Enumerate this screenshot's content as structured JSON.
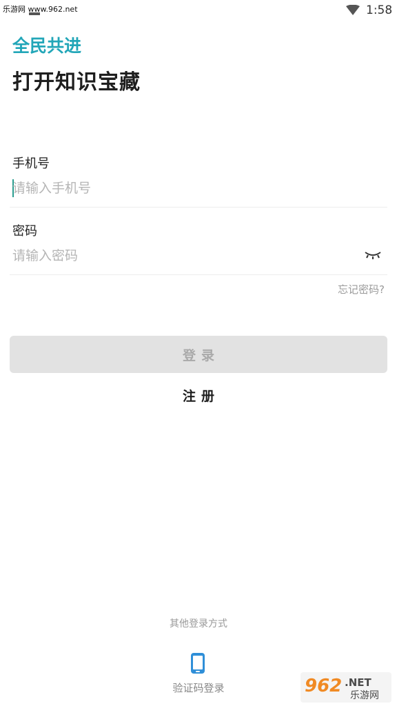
{
  "status_bar": {
    "watermark": "乐游网 www.962.net",
    "time": "1:58",
    "wifi_icon": "wifi-icon"
  },
  "brand": {
    "logo_text": "全民共进",
    "color": "#22a6b8"
  },
  "title": "打开知识宝藏",
  "phone": {
    "label": "手机号",
    "placeholder": "请输入手机号",
    "value": ""
  },
  "password": {
    "label": "密码",
    "placeholder": "请输入密码",
    "value": "",
    "toggle_icon": "eye-closed-icon"
  },
  "forgot_password": "忘记密码?",
  "login_button": "登录",
  "register_button": "注册",
  "other_login": {
    "title": "其他登录方式",
    "sms_label": "验证码登录",
    "icon": "phone-icon"
  },
  "watermark_logo": {
    "number": "962",
    "suffix": ".NET",
    "tagline": "乐游网"
  },
  "colors": {
    "accent": "#22a6b8",
    "button_disabled": "#e2e2e2",
    "icon_blue": "#2f8fd8"
  }
}
